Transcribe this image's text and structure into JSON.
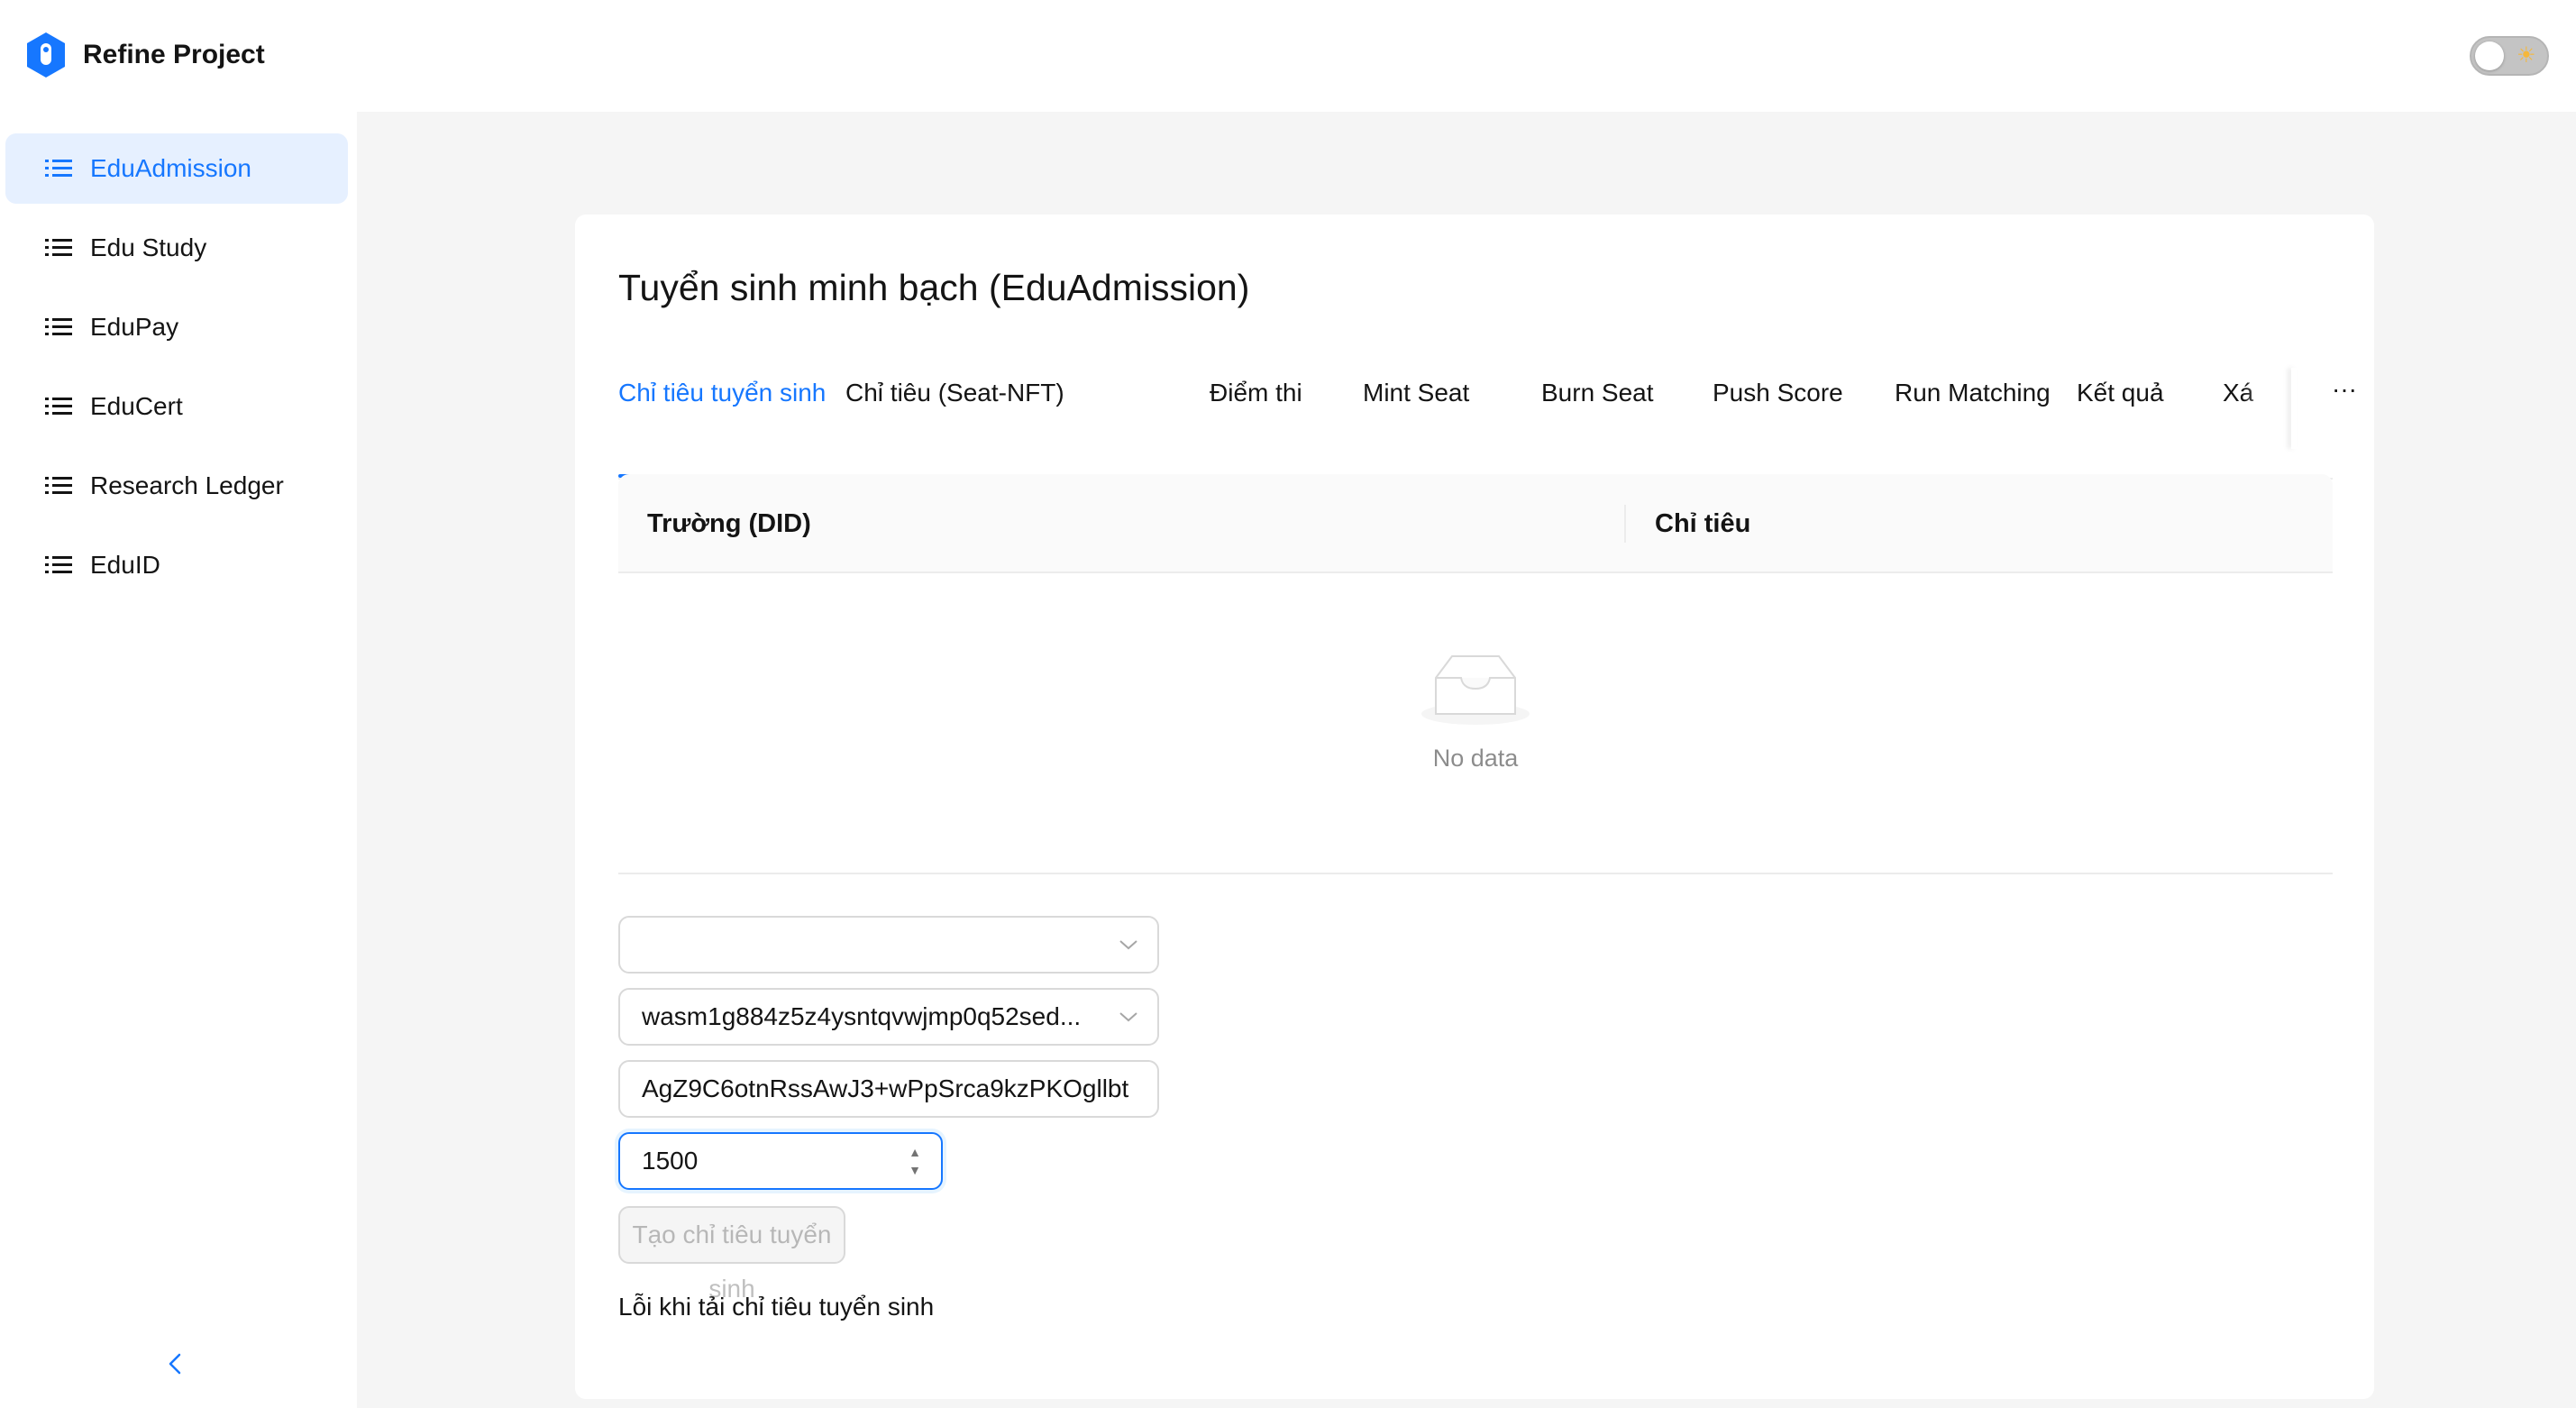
{
  "app": {
    "title": "Refine Project"
  },
  "sidebar": {
    "items": [
      {
        "label": "EduAdmission",
        "active": true
      },
      {
        "label": "Edu Study",
        "active": false
      },
      {
        "label": "EduPay",
        "active": false
      },
      {
        "label": "EduCert",
        "active": false
      },
      {
        "label": "Research Ledger",
        "active": false
      },
      {
        "label": "EduID",
        "active": false
      }
    ],
    "collapse_icon": "chevron-left-icon"
  },
  "page": {
    "title": "Tuyển sinh minh bạch (EduAdmission)",
    "tabs": [
      {
        "label": "Chỉ tiêu tuyển sinh",
        "active": true
      },
      {
        "label": "Chỉ tiêu (Seat-NFT)"
      },
      {
        "label": "Điểm thi"
      },
      {
        "label": "Mint Seat"
      },
      {
        "label": "Burn Seat"
      },
      {
        "label": "Push Score"
      },
      {
        "label": "Run Matching"
      },
      {
        "label": "Kết quả"
      },
      {
        "label": "Xá"
      }
    ],
    "tabs_more": "···"
  },
  "table": {
    "columns": [
      "Trường (DID)",
      "Chỉ tiêu"
    ],
    "empty_text": "No data"
  },
  "form": {
    "school_select_value": "",
    "contract_select_value": "wasm1g884z5z4ysntqvwjmp0q52sed...",
    "key_input_value": "AgZ9C6otnRssAwJ3+wPpSrca9kzPKOgllbt",
    "quota_value": "1500",
    "submit_label": "Tạo chỉ tiêu tuyển sinh",
    "error_text": "Lỗi khi tải chỉ tiêu tuyển sinh"
  },
  "colors": {
    "primary": "#1677ff",
    "active_bg": "#e6f0ff",
    "page_bg": "#f5f5f5"
  }
}
